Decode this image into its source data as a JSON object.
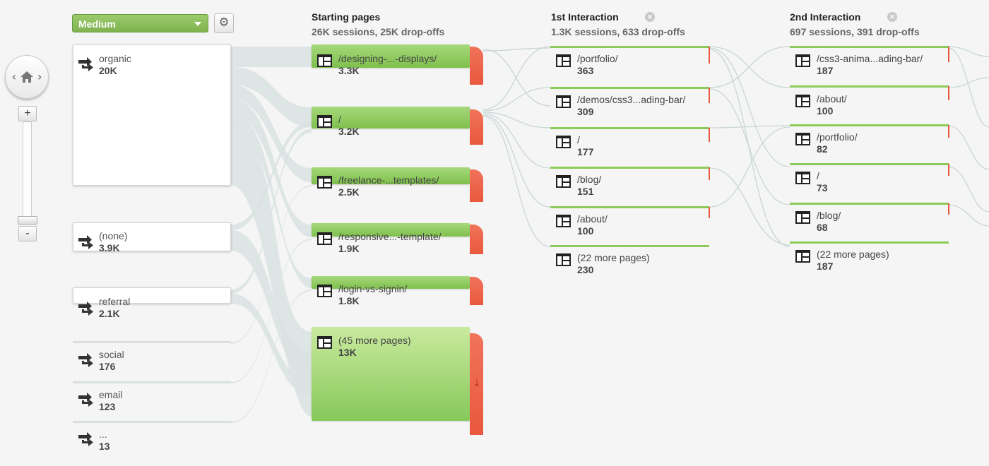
{
  "controls": {
    "dimension_select": "Medium",
    "zoom_in_label": "+",
    "zoom_out_label": "-",
    "nav_left": "‹",
    "nav_right": "›",
    "settings_icon": "gear-icon",
    "home_icon": "home-icon"
  },
  "columns": {
    "starting": {
      "title": "Starting pages",
      "sub": "26K sessions, 25K drop-offs"
    },
    "first": {
      "title": "1st Interaction",
      "sub": "1.3K sessions, 633 drop-offs"
    },
    "second": {
      "title": "2nd Interaction",
      "sub": "697 sessions, 391 drop-offs"
    }
  },
  "sources": [
    {
      "label": "organic",
      "value": "20K"
    },
    {
      "label": "(none)",
      "value": "3.9K"
    },
    {
      "label": "referral",
      "value": "2.1K"
    },
    {
      "label": "social",
      "value": "176"
    },
    {
      "label": "email",
      "value": "123"
    },
    {
      "label": "...",
      "value": "13"
    }
  ],
  "starting_pages": [
    {
      "label": "/designing-...-displays/",
      "value": "3.3K"
    },
    {
      "label": "/",
      "value": "3.2K"
    },
    {
      "label": "/freelance-...templates/",
      "value": "2.5K"
    },
    {
      "label": "/responsive...-template/",
      "value": "1.9K"
    },
    {
      "label": "/login-vs-signin/",
      "value": "1.8K"
    },
    {
      "label": "(45 more pages)",
      "value": "13K"
    }
  ],
  "first_interaction": [
    {
      "label": "/portfolio/",
      "value": "363"
    },
    {
      "label": "/demos/css3...ading-bar/",
      "value": "309"
    },
    {
      "label": "/",
      "value": "177"
    },
    {
      "label": "/blog/",
      "value": "151"
    },
    {
      "label": "/about/",
      "value": "100"
    },
    {
      "label": "(22 more pages)",
      "value": "230"
    }
  ],
  "second_interaction": [
    {
      "label": "/css3-anima...ading-bar/",
      "value": "187"
    },
    {
      "label": "/about/",
      "value": "100"
    },
    {
      "label": "/portfolio/",
      "value": "82"
    },
    {
      "label": "/",
      "value": "73"
    },
    {
      "label": "/blog/",
      "value": "68"
    },
    {
      "label": "(22 more pages)",
      "value": "187"
    }
  ],
  "colors": {
    "node_green": "#8ccb5a",
    "drop_red": "#e9583e",
    "flow_gray": "#d5dede",
    "select_green": "#8dbf5e"
  }
}
